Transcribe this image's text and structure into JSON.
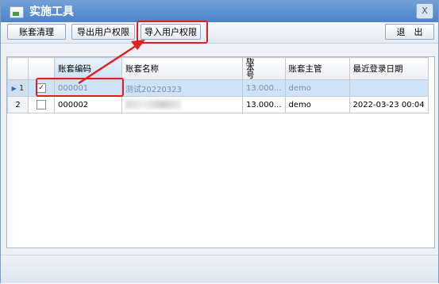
{
  "window": {
    "title": "实施工具",
    "close_label": "X"
  },
  "toolbar": {
    "clean_label": "账套清理",
    "export_label": "导出用户权限",
    "import_label": "导入用户权限",
    "exit_label": "退　出"
  },
  "grid": {
    "columns": [
      "",
      "",
      "账套编码",
      "账套名称",
      "版本号",
      "账套主管",
      "最近登录日期"
    ],
    "rows": [
      {
        "no": "1",
        "checked": true,
        "code": "000001",
        "name": "测试20220323",
        "version": "13.000...",
        "manager": "demo",
        "last_login": ""
      },
      {
        "no": "2",
        "checked": false,
        "code": "000002",
        "name": "",
        "version": "13.000...",
        "manager": "demo",
        "last_login": "2022-03-23 00:04"
      }
    ]
  },
  "colors": {
    "annotation": "#e02020",
    "title_bar": "#5a8dd0",
    "selected_row": "#cfe3f8"
  }
}
